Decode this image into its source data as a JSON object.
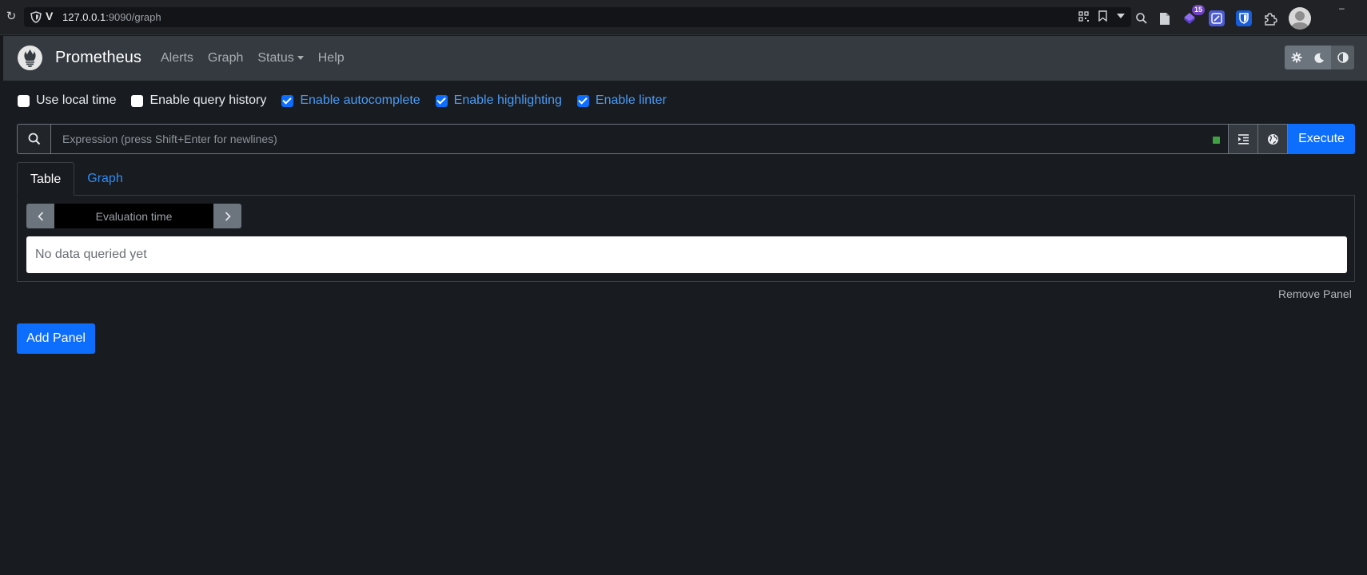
{
  "browser": {
    "url_host": "127.0.0.1",
    "url_rest": ":9090/graph",
    "extension_badge": "15",
    "icons": [
      "reload-icon",
      "shield-icon",
      "qr-code-icon",
      "bookmark-icon",
      "dropdown-icon",
      "zoom-icon",
      "reader-icon",
      "extension-icon",
      "puzzle-icon",
      "avatar"
    ]
  },
  "navbar": {
    "brand": "Prometheus",
    "links": [
      "Alerts",
      "Graph",
      "Status",
      "Help"
    ]
  },
  "options": [
    {
      "label": "Use local time",
      "checked": false
    },
    {
      "label": "Enable query history",
      "checked": false
    },
    {
      "label": "Enable autocomplete",
      "checked": true
    },
    {
      "label": "Enable highlighting",
      "checked": true
    },
    {
      "label": "Enable linter",
      "checked": true
    }
  ],
  "expression": {
    "placeholder": "Expression (press Shift+Enter for newlines)",
    "execute_label": "Execute"
  },
  "tabs": {
    "table": "Table",
    "graph": "Graph"
  },
  "panel": {
    "eval_time_placeholder": "Evaluation time",
    "no_data": "No data queried yet",
    "remove_label": "Remove Panel"
  },
  "add_panel_label": "Add Panel",
  "colors": {
    "accent": "#0d6efd",
    "navbar": "#343a40",
    "background": "#181b1f",
    "status_ok": "#3fa142"
  }
}
